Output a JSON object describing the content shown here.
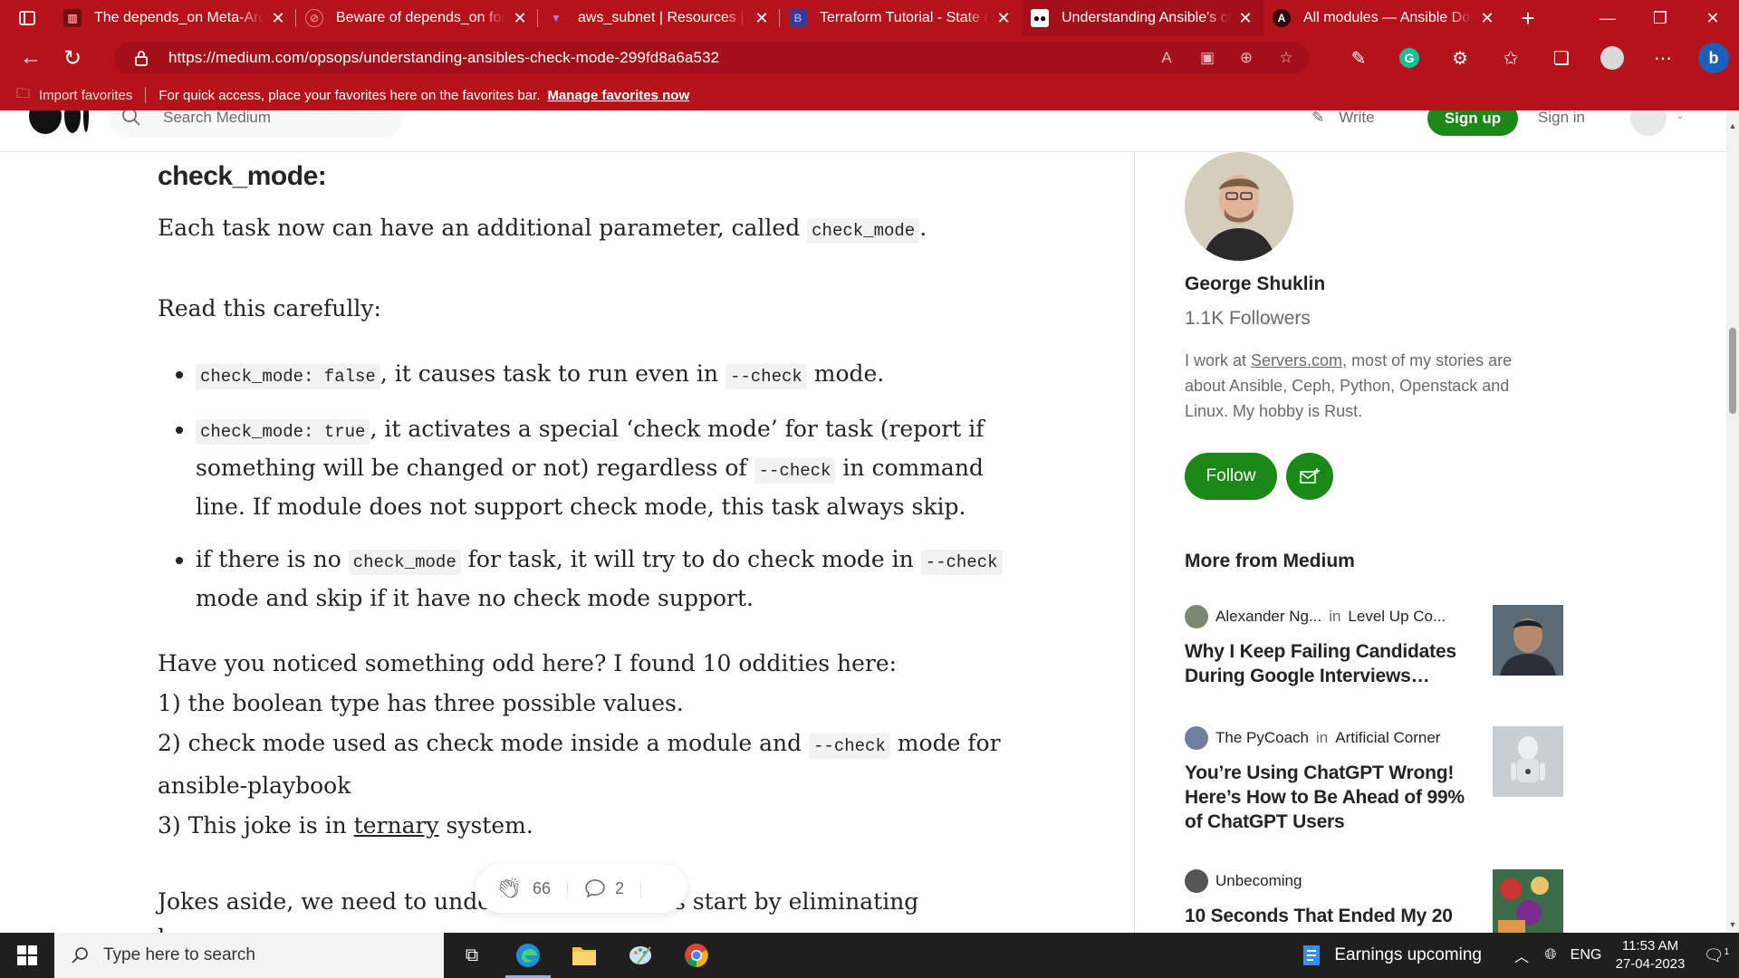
{
  "browser": {
    "tabs": [
      {
        "title": "The depends_on Meta-Argu",
        "icon": "github-icon"
      },
      {
        "title": "Beware of depends_on for T",
        "icon": "github-icon"
      },
      {
        "title": "aws_subnet | Resources | ha",
        "icon": "terraform-icon"
      },
      {
        "title": "Terraform Tutorial - State (te",
        "icon": "bogotobogo-icon"
      },
      {
        "title": "Understanding Ansible's ch",
        "icon": "medium-icon",
        "active": true
      },
      {
        "title": "All modules — Ansible Doc",
        "icon": "ansible-icon"
      }
    ],
    "url": "https://medium.com/opsops/understanding-ansibles-check-mode-299fd8a6a532",
    "favorites_bar": {
      "import_label": "Import favorites",
      "message": "For quick access, place your favorites here on the favorites bar.",
      "manage_link": "Manage favorites now"
    },
    "accent_color": "#b5121b"
  },
  "medium_header": {
    "search_placeholder": "Search Medium",
    "write_label": "Write",
    "signup_label": "Sign up",
    "signin_label": "Sign in"
  },
  "article": {
    "heading": "check_mode:",
    "intro_pre": "Each task now can have an additional parameter, called ",
    "intro_code": "check_mode",
    "intro_post": ".",
    "read_carefully": "Read this carefully:",
    "bullets": [
      {
        "code1": "check_mode: false",
        "t1": ", it causes task to run even in ",
        "code2": "--check",
        "t2": " mode."
      },
      {
        "code1": "check_mode: true",
        "t1": ", it activates a special ‘check mode’ for task (report if something will be changed or not) regardless of ",
        "code2": "--check",
        "t2": " in command line. If module does not support check mode, this task always skip."
      },
      {
        "t0": "if there is no ",
        "code1": "check_mode",
        "t1": " for task, it will try to do check mode in ",
        "code2": "--check",
        "t2": " mode and skip if it have no check mode support."
      }
    ],
    "oddities_intro": "Have you noticed something odd here? I found 10 oddities here:",
    "odd1": "1) the boolean type has three possible values.",
    "odd2_pre": "2) check mode used as check mode inside a module and ",
    "odd2_code": "--check",
    "odd2_post": " mode for ansible-playbook",
    "odd3_pre": "3) This joke is in ",
    "odd3_link": "ternary",
    "odd3_post": " system.",
    "jokes": "Jokes aside, we need to understand this. Let’s start by eliminating homonyms"
  },
  "engagement": {
    "claps": "66",
    "responses": "2"
  },
  "sidebar": {
    "author_name": "George Shuklin",
    "followers": "1.1K Followers",
    "bio_pre": "I work at ",
    "bio_link": "Servers.com",
    "bio_post": ", most of my stories are about Ansible, Ceph, Python, Openstack and Linux. My hobby is Rust.",
    "follow_label": "Follow",
    "more_title": "More from Medium",
    "cards": [
      {
        "author": "Alexander Ng...",
        "in": "in",
        "pub": "Level Up Co...",
        "title": "Why I Keep Failing Candidates During Google Interviews…"
      },
      {
        "author": "The PyCoach",
        "in": "in",
        "pub": "Artificial Corner",
        "title": "You’re Using ChatGPT Wrong! Here’s How to Be Ahead of 99% of ChatGPT Users"
      },
      {
        "author": "Unbecoming",
        "in": "",
        "pub": "",
        "title": "10 Seconds That Ended My 20"
      }
    ]
  },
  "taskbar": {
    "search_placeholder": "Type here to search",
    "news": "Earnings upcoming",
    "lang": "ENG",
    "time": "11:53 AM",
    "date": "27-04-2023",
    "notif_count": "1"
  }
}
